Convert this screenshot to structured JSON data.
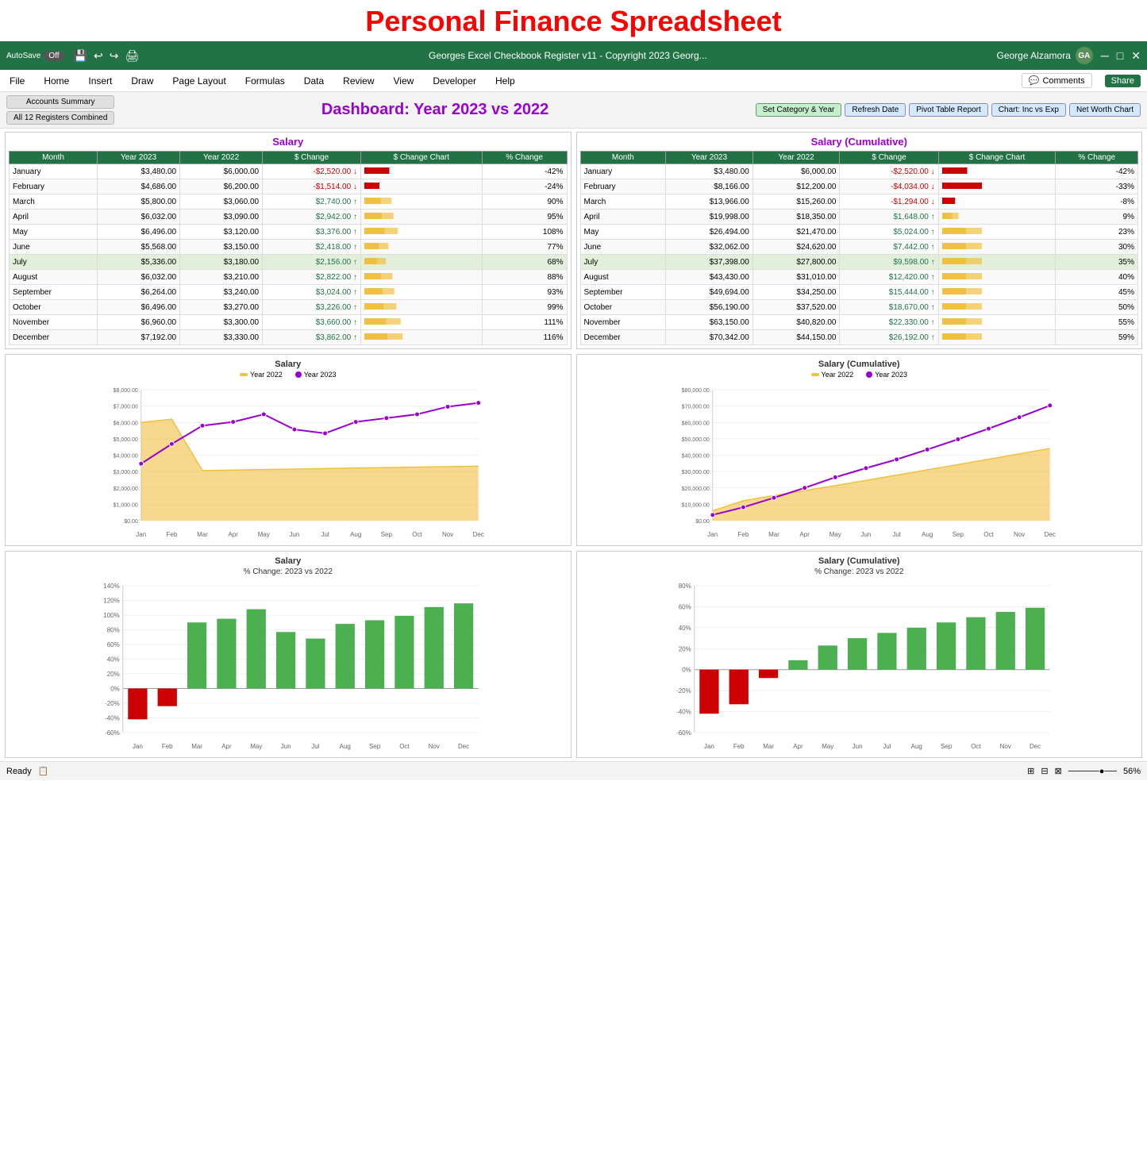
{
  "page": {
    "title": "Personal Finance Spreadsheet"
  },
  "ribbon": {
    "autosave": "AutoSave",
    "autosave_state": "Off",
    "file_title": "Georges Excel Checkbook Register v11 - Copyright 2023 Georg...",
    "user_name": "George Alzamora",
    "user_initials": "GA",
    "comments_label": "Comments",
    "share_label": "Share"
  },
  "menu": {
    "items": [
      "File",
      "Home",
      "Insert",
      "Draw",
      "Page Layout",
      "Formulas",
      "Data",
      "Review",
      "View",
      "Developer",
      "Help"
    ]
  },
  "toolbar": {
    "btn_accounts": "Accounts Summary",
    "btn_registers": "All 12 Registers Combined",
    "dashboard_title": "Dashboard: Year 2023 vs 2022",
    "btn_set_category": "Set Category & Year",
    "btn_refresh": "Refresh Date",
    "btn_pivot": "Pivot Table Report",
    "btn_chart_inc_exp": "Chart: Inc vs Exp",
    "btn_net_worth": "Net Worth Chart"
  },
  "salary_table": {
    "title": "Salary",
    "headers": [
      "Month",
      "Year 2023",
      "Year 2022",
      "$ Change",
      "$ Change Chart",
      "% Change"
    ],
    "rows": [
      {
        "month": "January",
        "y2023": "$3,480.00",
        "y2022": "$6,000.00",
        "change": "-$2,520.00",
        "pct": "-42%",
        "neg": true
      },
      {
        "month": "February",
        "y2023": "$4,686.00",
        "y2022": "$6,200.00",
        "change": "-$1,514.00",
        "pct": "-24%",
        "neg": true
      },
      {
        "month": "March",
        "y2023": "$5,800.00",
        "y2022": "$3,060.00",
        "change": "$2,740.00",
        "pct": "90%",
        "neg": false
      },
      {
        "month": "April",
        "y2023": "$6,032.00",
        "y2022": "$3,090.00",
        "change": "$2,942.00",
        "pct": "95%",
        "neg": false
      },
      {
        "month": "May",
        "y2023": "$6,496.00",
        "y2022": "$3,120.00",
        "change": "$3,376.00",
        "pct": "108%",
        "neg": false
      },
      {
        "month": "June",
        "y2023": "$5,568.00",
        "y2022": "$3,150.00",
        "change": "$2,418.00",
        "pct": "77%",
        "neg": false
      },
      {
        "month": "July",
        "y2023": "$5,336.00",
        "y2022": "$3,180.00",
        "change": "$2,156.00",
        "pct": "68%",
        "neg": false,
        "highlight": true
      },
      {
        "month": "August",
        "y2023": "$6,032.00",
        "y2022": "$3,210.00",
        "change": "$2,822.00",
        "pct": "88%",
        "neg": false
      },
      {
        "month": "September",
        "y2023": "$6,264.00",
        "y2022": "$3,240.00",
        "change": "$3,024.00",
        "pct": "93%",
        "neg": false
      },
      {
        "month": "October",
        "y2023": "$6,496.00",
        "y2022": "$3,270.00",
        "change": "$3,226.00",
        "pct": "99%",
        "neg": false
      },
      {
        "month": "November",
        "y2023": "$6,960.00",
        "y2022": "$3,300.00",
        "change": "$3,660.00",
        "pct": "111%",
        "neg": false
      },
      {
        "month": "December",
        "y2023": "$7,192.00",
        "y2022": "$3,330.00",
        "change": "$3,862.00",
        "pct": "116%",
        "neg": false
      }
    ]
  },
  "salary_cumulative_table": {
    "title": "Salary (Cumulative)",
    "headers": [
      "Month",
      "Year 2023",
      "Year 2022",
      "$ Change",
      "$ Change Chart",
      "% Change"
    ],
    "rows": [
      {
        "month": "January",
        "y2023": "$3,480.00",
        "y2022": "$6,000.00",
        "change": "-$2,520.00",
        "pct": "-42%",
        "neg": true
      },
      {
        "month": "February",
        "y2023": "$8,166.00",
        "y2022": "$12,200.00",
        "change": "-$4,034.00",
        "pct": "-33%",
        "neg": true
      },
      {
        "month": "March",
        "y2023": "$13,966.00",
        "y2022": "$15,260.00",
        "change": "-$1,294.00",
        "pct": "-8%",
        "neg": true
      },
      {
        "month": "April",
        "y2023": "$19,998.00",
        "y2022": "$18,350.00",
        "change": "$1,648.00",
        "pct": "9%",
        "neg": false
      },
      {
        "month": "May",
        "y2023": "$26,494.00",
        "y2022": "$21,470.00",
        "change": "$5,024.00",
        "pct": "23%",
        "neg": false
      },
      {
        "month": "June",
        "y2023": "$32,062.00",
        "y2022": "$24,620.00",
        "change": "$7,442.00",
        "pct": "30%",
        "neg": false
      },
      {
        "month": "July",
        "y2023": "$37,398.00",
        "y2022": "$27,800.00",
        "change": "$9,598.00",
        "pct": "35%",
        "neg": false,
        "highlight": true
      },
      {
        "month": "August",
        "y2023": "$43,430.00",
        "y2022": "$31,010.00",
        "change": "$12,420.00",
        "pct": "40%",
        "neg": false
      },
      {
        "month": "September",
        "y2023": "$49,694.00",
        "y2022": "$34,250.00",
        "change": "$15,444.00",
        "pct": "45%",
        "neg": false
      },
      {
        "month": "October",
        "y2023": "$56,190.00",
        "y2022": "$37,520.00",
        "change": "$18,670.00",
        "pct": "50%",
        "neg": false
      },
      {
        "month": "November",
        "y2023": "$63,150.00",
        "y2022": "$40,820.00",
        "change": "$22,330.00",
        "pct": "55%",
        "neg": false
      },
      {
        "month": "December",
        "y2023": "$70,342.00",
        "y2022": "$44,150.00",
        "change": "$26,192.00",
        "pct": "59%",
        "neg": false
      }
    ]
  },
  "charts": {
    "salary": {
      "title": "Salary",
      "legend_2022": "Year 2022",
      "legend_2023": "Year 2023",
      "months": [
        "Jan",
        "Feb",
        "Mar",
        "Apr",
        "May",
        "Jun",
        "Jul",
        "Aug",
        "Sep",
        "Oct",
        "Nov",
        "Dec"
      ],
      "data_2022": [
        6000,
        6200,
        3060,
        3090,
        3120,
        3150,
        3180,
        3210,
        3240,
        3270,
        3300,
        3330
      ],
      "data_2023": [
        3480,
        4686,
        5800,
        6032,
        6496,
        5568,
        5336,
        6032,
        6264,
        6496,
        6960,
        7192
      ],
      "y_labels": [
        "$0.00",
        "$1,000.00",
        "$2,000.00",
        "$3,000.00",
        "$4,000.00",
        "$5,000.00",
        "$6,000.00",
        "$7,000.00",
        "$8,000.00"
      ],
      "y_max": 8000
    },
    "salary_cumulative": {
      "title": "Salary (Cumulative)",
      "legend_2022": "Year 2022",
      "legend_2023": "Year 2023",
      "months": [
        "Jan",
        "Feb",
        "Mar",
        "Apr",
        "May",
        "Jun",
        "Jul",
        "Aug",
        "Sep",
        "Oct",
        "Nov",
        "Dec"
      ],
      "data_2022": [
        6000,
        12200,
        15260,
        18350,
        21470,
        24620,
        27800,
        31010,
        34250,
        37520,
        40820,
        44150
      ],
      "data_2023": [
        3480,
        8166,
        13966,
        19998,
        26494,
        32062,
        37398,
        43430,
        49694,
        56190,
        63150,
        70342
      ],
      "y_labels": [
        "$0.00",
        "$10,000.00",
        "$20,000.00",
        "$30,000.00",
        "$40,000.00",
        "$50,000.00",
        "$60,000.00",
        "$70,000.00",
        "$80,000.00"
      ],
      "y_max": 80000
    },
    "salary_pct": {
      "title": "Salary",
      "subtitle": "% Change: 2023 vs 2022",
      "months": [
        "Jan",
        "Feb",
        "Mar",
        "Apr",
        "May",
        "Jun",
        "Jul",
        "Aug",
        "Sep",
        "Oct",
        "Nov",
        "Dec"
      ],
      "data": [
        -42,
        -24,
        90,
        95,
        108,
        77,
        68,
        88,
        93,
        99,
        111,
        116
      ],
      "y_labels": [
        "-60%",
        "-40%",
        "-20%",
        "0%",
        "20%",
        "40%",
        "60%",
        "80%",
        "100%",
        "120%",
        "140%"
      ],
      "y_max": 140,
      "y_min": -60
    },
    "salary_cumulative_pct": {
      "title": "Salary (Cumulative)",
      "subtitle": "% Change: 2023 vs 2022",
      "months": [
        "Jan",
        "Feb",
        "Mar",
        "Apr",
        "May",
        "Jun",
        "Jul",
        "Aug",
        "Sep",
        "Oct",
        "Nov",
        "Dec"
      ],
      "data": [
        -42,
        -33,
        -8,
        9,
        23,
        30,
        35,
        40,
        45,
        50,
        55,
        59
      ],
      "y_labels": [
        "-60%",
        "-40%",
        "-20%",
        "0%",
        "20%",
        "40%",
        "60%",
        "80%"
      ],
      "y_max": 80,
      "y_min": -60
    }
  },
  "status": {
    "ready": "Ready",
    "zoom": "56%"
  }
}
